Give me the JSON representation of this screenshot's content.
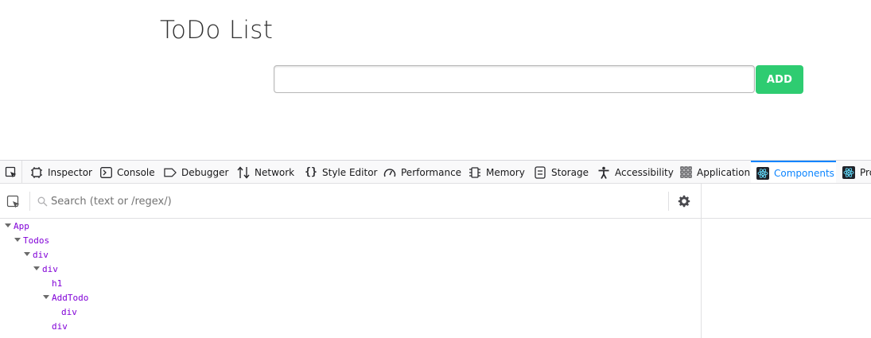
{
  "app": {
    "title": "ToDo List",
    "input_value": "",
    "add_label": "ADD",
    "add_color": "#2ecc71"
  },
  "devtools": {
    "tabs": [
      {
        "label": "Inspector",
        "icon": "inspector-icon"
      },
      {
        "label": "Console",
        "icon": "console-icon"
      },
      {
        "label": "Debugger",
        "icon": "debugger-icon"
      },
      {
        "label": "Network",
        "icon": "network-icon"
      },
      {
        "label": "Style Editor",
        "icon": "style-editor-icon"
      },
      {
        "label": "Performance",
        "icon": "performance-icon"
      },
      {
        "label": "Memory",
        "icon": "memory-icon"
      },
      {
        "label": "Storage",
        "icon": "storage-icon"
      },
      {
        "label": "Accessibility",
        "icon": "accessibility-icon"
      },
      {
        "label": "Application",
        "icon": "application-icon"
      },
      {
        "label": "Components",
        "icon": "react-icon",
        "selected": true
      },
      {
        "label": "Pro",
        "icon": "react-icon"
      }
    ],
    "accent_color": "#0a84ff",
    "search_placeholder": "Search (text or /regex/)",
    "tree": [
      {
        "label": "App",
        "depth": 0,
        "expanded": true
      },
      {
        "label": "Todos",
        "depth": 1,
        "expanded": true
      },
      {
        "label": "div",
        "depth": 2,
        "expanded": true
      },
      {
        "label": "div",
        "depth": 3,
        "expanded": true
      },
      {
        "label": "h1",
        "depth": 4,
        "expanded": false
      },
      {
        "label": "AddTodo",
        "depth": 4,
        "expanded": true
      },
      {
        "label": "div",
        "depth": 5,
        "expanded": false
      },
      {
        "label": "div",
        "depth": 4,
        "expanded": false
      }
    ],
    "tree_color": "#8000d7"
  }
}
